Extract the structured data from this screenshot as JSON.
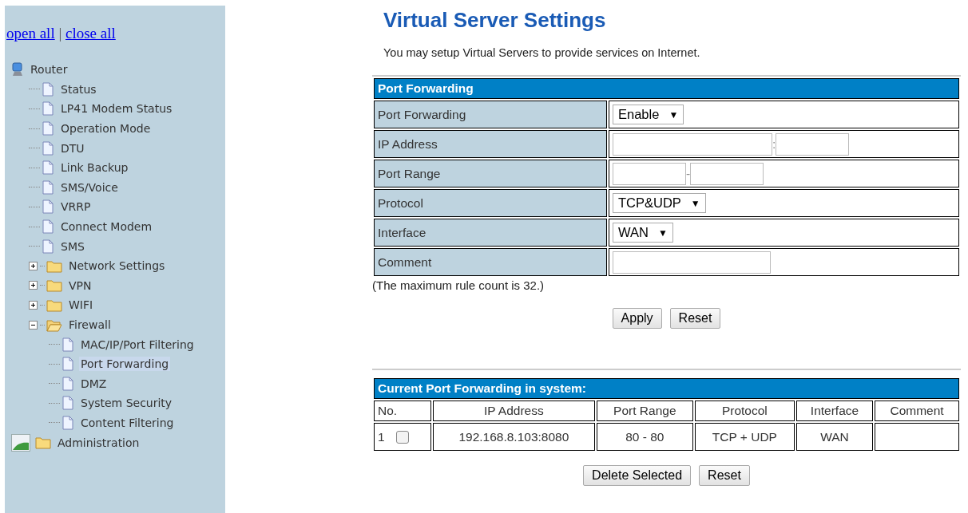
{
  "sidebar": {
    "links": [
      "open all",
      "close all"
    ],
    "separator": "|",
    "tree": [
      {
        "label": "Router",
        "kind": "root",
        "selected": false,
        "children": [
          {
            "label": "Status",
            "kind": "page",
            "selected": false
          },
          {
            "label": "LP41 Modem Status",
            "kind": "page",
            "selected": false
          },
          {
            "label": "Operation Mode",
            "kind": "page",
            "selected": false
          },
          {
            "label": "DTU",
            "kind": "page",
            "selected": false
          },
          {
            "label": "Link Backup",
            "kind": "page",
            "selected": false
          },
          {
            "label": "SMS/Voice",
            "kind": "page",
            "selected": false
          },
          {
            "label": "VRRP",
            "kind": "page",
            "selected": false
          },
          {
            "label": "Connect Modem",
            "kind": "page",
            "selected": false
          },
          {
            "label": "SMS",
            "kind": "page",
            "selected": false
          },
          {
            "label": "Network Settings",
            "kind": "folder",
            "expanded": false,
            "selected": false
          },
          {
            "label": "VPN",
            "kind": "folder",
            "expanded": false,
            "selected": false
          },
          {
            "label": "WIFI",
            "kind": "folder",
            "expanded": false,
            "selected": false
          },
          {
            "label": "Firewall",
            "kind": "folder",
            "expanded": true,
            "selected": false,
            "children": [
              {
                "label": "MAC/IP/Port Filtering",
                "kind": "page",
                "selected": false
              },
              {
                "label": "Port Forwarding",
                "kind": "page",
                "selected": true
              },
              {
                "label": "DMZ",
                "kind": "page",
                "selected": false
              },
              {
                "label": "System Security",
                "kind": "page",
                "selected": false
              },
              {
                "label": "Content Filtering",
                "kind": "page",
                "selected": false
              }
            ]
          }
        ]
      },
      {
        "label": "Administration",
        "kind": "broken-folder",
        "selected": false
      }
    ]
  },
  "title": "Virtual Server Settings",
  "subtitle": "You may setup Virtual Servers to provide services on Internet.",
  "form": {
    "header": "Port Forwarding",
    "rows": [
      {
        "label": "Port Forwarding",
        "kind": "select",
        "value": "Enable",
        "caret": "▼"
      },
      {
        "label": "IP Address",
        "kind": "pair",
        "separator": ":"
      },
      {
        "label": "Port Range",
        "kind": "pair",
        "separator": "-"
      },
      {
        "label": "Protocol",
        "kind": "select",
        "value": "TCP&UDP",
        "caret": "▼"
      },
      {
        "label": "Interface",
        "kind": "select",
        "value": "WAN",
        "caret": "▼"
      },
      {
        "label": "Comment",
        "kind": "text"
      }
    ],
    "note": "(The maximum rule count is 32.)",
    "buttons": [
      "Apply",
      "Reset"
    ]
  },
  "rules": {
    "header": "Current Port Forwarding in system:",
    "columns": [
      "No.",
      "IP Address",
      "Port Range",
      "Protocol",
      "Interface",
      "Comment"
    ],
    "rows": [
      {
        "checked": false,
        "cells": [
          "1",
          "192.168.8.103:8080",
          "80 - 80",
          "TCP + UDP",
          "WAN"
        ]
      }
    ],
    "buttons": [
      "Delete Selected",
      "Reset"
    ]
  }
}
